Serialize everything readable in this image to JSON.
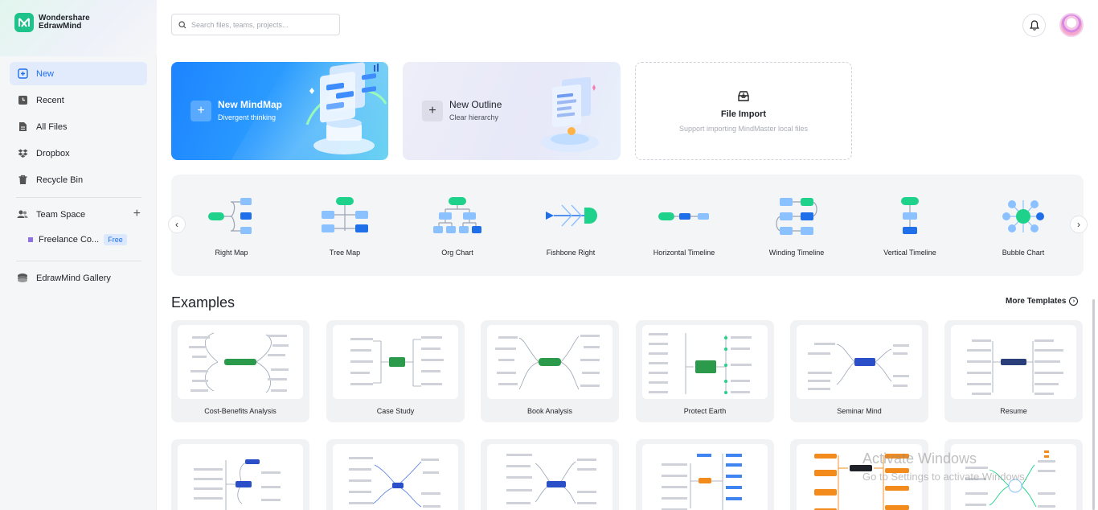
{
  "app": {
    "brand_line1": "Wondershare",
    "brand_line2": "EdrawMind"
  },
  "sidebar": {
    "items": [
      {
        "label": "New",
        "icon": "new-file-icon",
        "active": true
      },
      {
        "label": "Recent",
        "icon": "clock-icon"
      },
      {
        "label": "All Files",
        "icon": "files-icon"
      },
      {
        "label": "Dropbox",
        "icon": "dropbox-icon"
      },
      {
        "label": "Recycle Bin",
        "icon": "trash-icon"
      }
    ],
    "team_space": "Team Space",
    "team_name": "Freelance Co...",
    "team_badge": "Free",
    "gallery": "EdrawMind Gallery"
  },
  "search": {
    "placeholder": "Search files, teams, projects..."
  },
  "cards": {
    "mindmap": {
      "title": "New MindMap",
      "subtitle": "Divergent thinking"
    },
    "outline": {
      "title": "New Outline",
      "subtitle": "Clear hierarchy"
    },
    "import": {
      "title": "File Import",
      "subtitle": "Support importing MindMaster local files"
    }
  },
  "templates": [
    "Right Map",
    "Tree Map",
    "Org Chart",
    "Fishbone Right",
    "Horizontal Timeline",
    "Winding Timeline",
    "Vertical Timeline",
    "Bubble Chart"
  ],
  "examples": {
    "title": "Examples",
    "more": "More Templates",
    "row1": [
      "Cost-Benefits Analysis",
      "Case Study",
      "Book Analysis",
      "Protect Earth",
      "Seminar Mind",
      "Resume"
    ]
  },
  "watermark": {
    "line1": "Activate Windows",
    "line2": "Go to Settings to activate Windows."
  },
  "colors": {
    "accent": "#1f6feb",
    "green": "#1ec28b",
    "blue_node": "#1f6feb",
    "light_node": "#8cc1ff"
  }
}
